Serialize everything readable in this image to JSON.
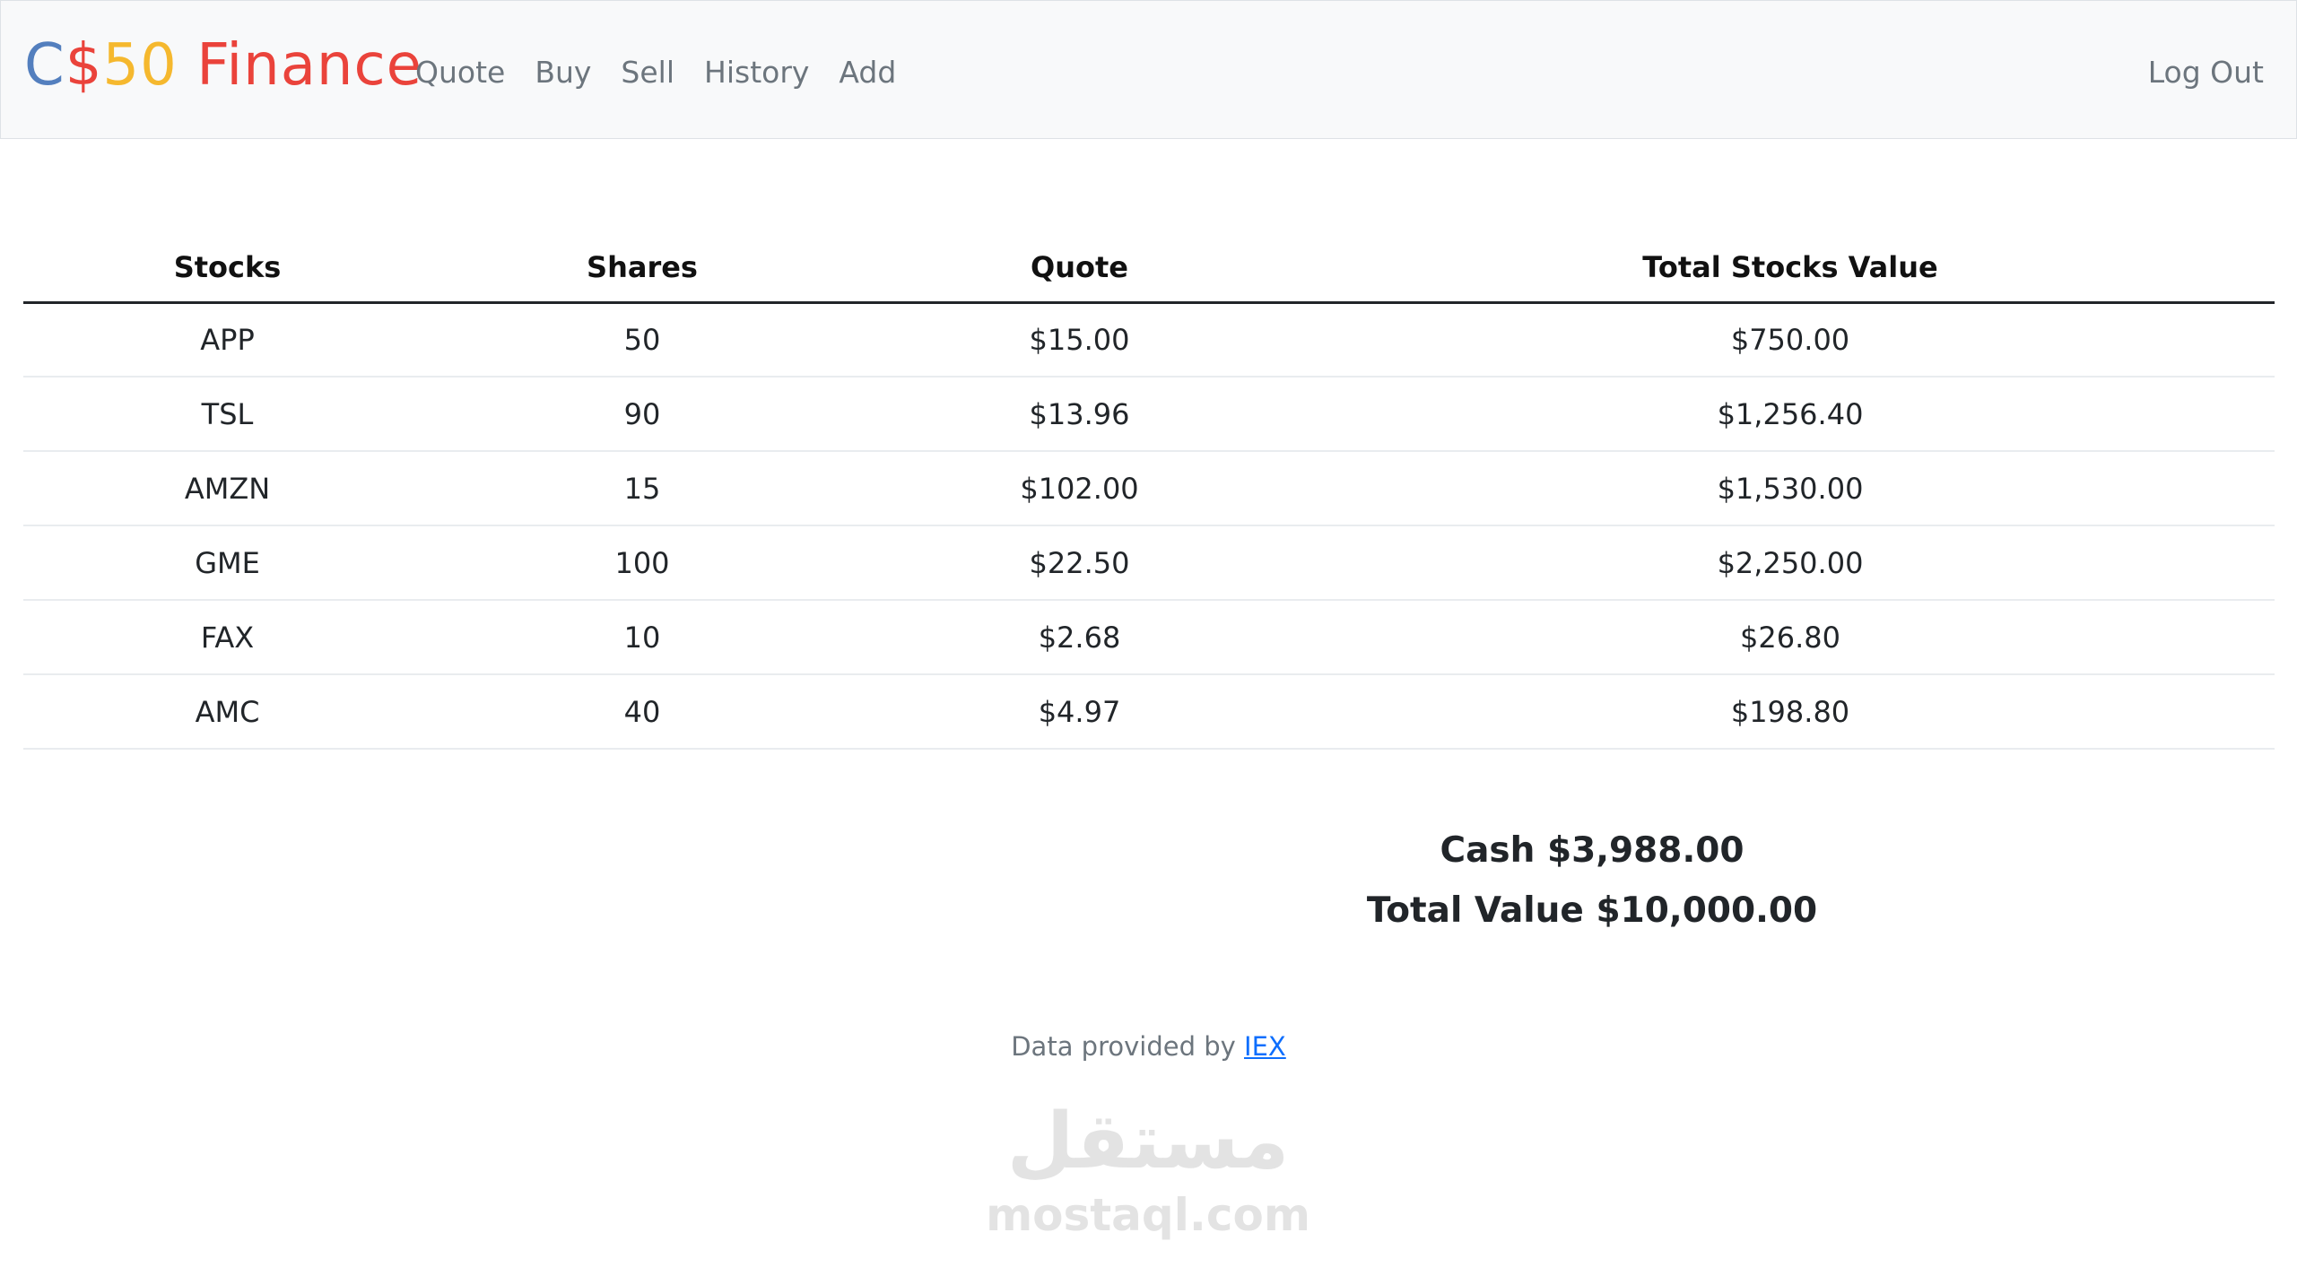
{
  "brand": {
    "parts": [
      "C",
      "$",
      "50",
      " Finance"
    ],
    "colors": [
      "#537fbe",
      "#ea433b",
      "#f5b82e",
      "#2e944b"
    ]
  },
  "nav": {
    "links": [
      "Quote",
      "Buy",
      "Sell",
      "History",
      "Add"
    ],
    "logout": "Log Out"
  },
  "table": {
    "headers": [
      "Stocks",
      "Shares",
      "Quote",
      "Total Stocks Value"
    ],
    "rows": [
      [
        "APP",
        "50",
        "$15.00",
        "$750.00"
      ],
      [
        "TSL",
        "90",
        "$13.96",
        "$1,256.40"
      ],
      [
        "AMZN",
        "15",
        "$102.00",
        "$1,530.00"
      ],
      [
        "GME",
        "100",
        "$22.50",
        "$2,250.00"
      ],
      [
        "FAX",
        "10",
        "$2.68",
        "$26.80"
      ],
      [
        "AMC",
        "40",
        "$4.97",
        "$198.80"
      ]
    ]
  },
  "totals": {
    "cash": "Cash $3,988.00",
    "total_value": "Total Value $10,000.00"
  },
  "footer": {
    "text": "Data provided by ",
    "link": "IEX"
  },
  "watermark": {
    "arabic": "مستقل",
    "latin": "mostaql.com"
  }
}
